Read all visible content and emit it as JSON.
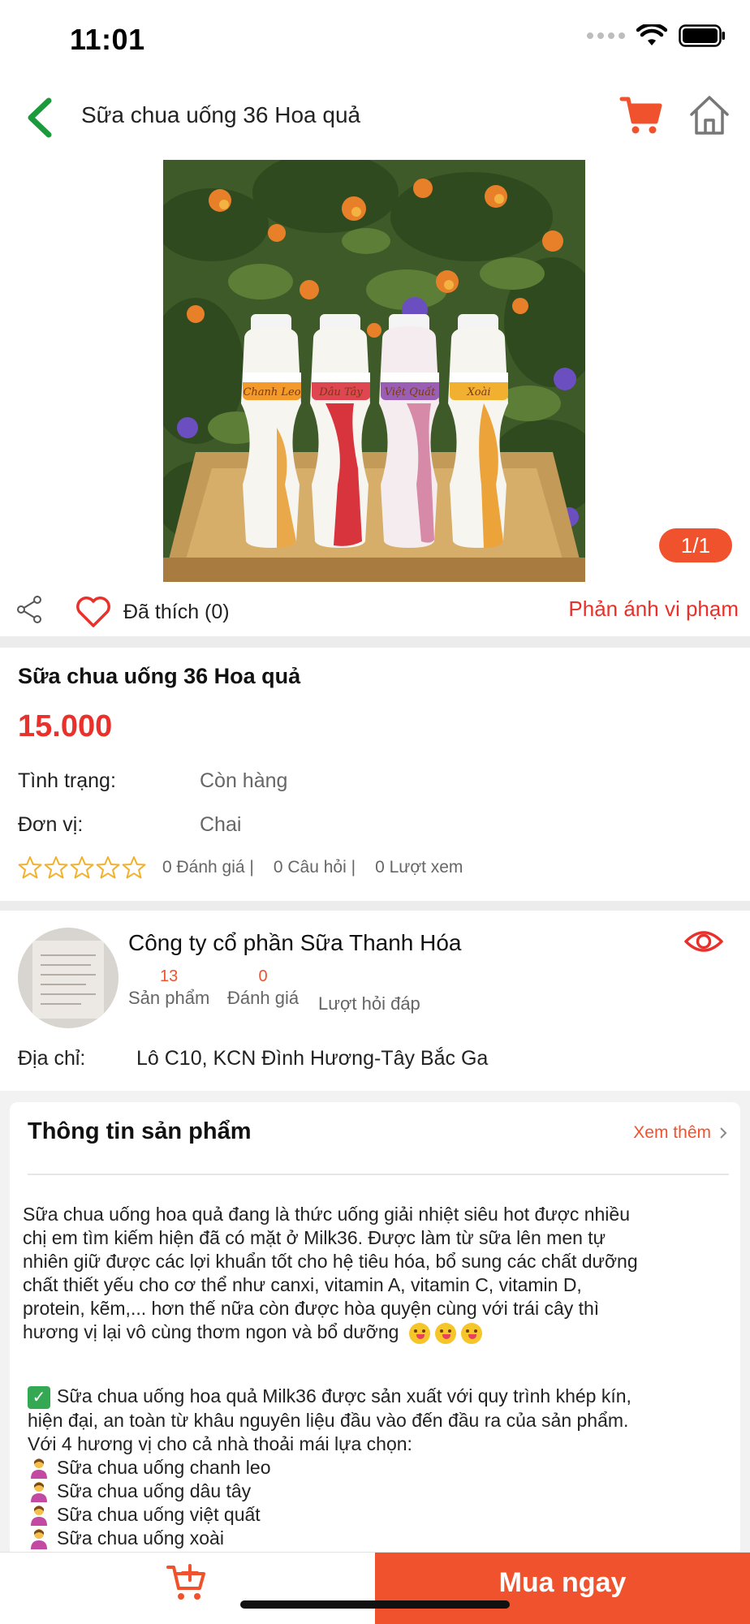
{
  "status_bar": {
    "time": "11:01"
  },
  "nav": {
    "title": "Sữa chua uống 36 Hoa quả"
  },
  "gallery": {
    "counter": "1/1",
    "bottle_labels": [
      "Chanh Leo",
      "Dâu Tây",
      "Việt Quất",
      "Xoài"
    ]
  },
  "actions": {
    "like_label": "Đã thích (0)",
    "report_label": "Phản ánh vi phạm"
  },
  "product": {
    "title": "Sữa chua uống 36 Hoa quả",
    "price": "15.000",
    "status_label": "Tình trạng:",
    "status_value": "Còn hàng",
    "unit_label": "Đơn vị:",
    "unit_value": "Chai",
    "rating_stars": 0,
    "reviews": "0 Đánh giá |",
    "questions": "0 Câu hỏi |",
    "views": "0 Lượt xem"
  },
  "seller": {
    "name": "Công ty cổ phần Sữa Thanh Hóa",
    "products_count": "13",
    "products_label": "Sản phẩm",
    "ratings_count": "0",
    "ratings_label": "Đánh giá",
    "qa_label": "Lượt hỏi đáp",
    "address_label": "Địa chỉ:",
    "address_value": "Lô C10, KCN Đình Hương-Tây Bắc Ga"
  },
  "info_card": {
    "title": "Thông tin sản phẩm",
    "see_more": "Xem thêm",
    "para1_lines": [
      "Sữa chua uống hoa quả đang là thức uống giải nhiệt siêu hot được nhiều",
      "chị em tìm kiếm hiện đã có mặt ở Milk36. Được làm từ sữa lên men tự",
      "nhiên giữ được các lợi khuẩn tốt cho hệ tiêu hóa, bổ sung các chất dưỡng",
      "chất thiết yếu cho cơ thể như canxi, vitamin A, vitamin C, vitamin D,",
      "protein, kẽm,... hơn thế nữa còn được hòa quyện cùng với trái cây thì",
      "hương vị lại vô cùng thơm ngon và bổ dưỡng"
    ],
    "para2_lines": [
      "Sữa chua uống hoa quả Milk36 được sản xuất với quy trình khép kín,",
      "hiện đại, an toàn từ khâu nguyên liệu đầu vào đến đầu ra của sản phẩm.",
      "Với 4 hương vị cho cả nhà thoải mái lựa chọn:"
    ],
    "flavors": [
      "Sữa chua uống chanh leo",
      "Sữa chua uống dâu tây",
      "Sữa chua uống việt quất",
      "Sữa chua uống xoài"
    ]
  },
  "bottom_bar": {
    "buy_now": "Mua ngay"
  },
  "colors": {
    "accent": "#f0522e",
    "price": "#e9302a",
    "back_arrow": "#1a9a3a"
  }
}
